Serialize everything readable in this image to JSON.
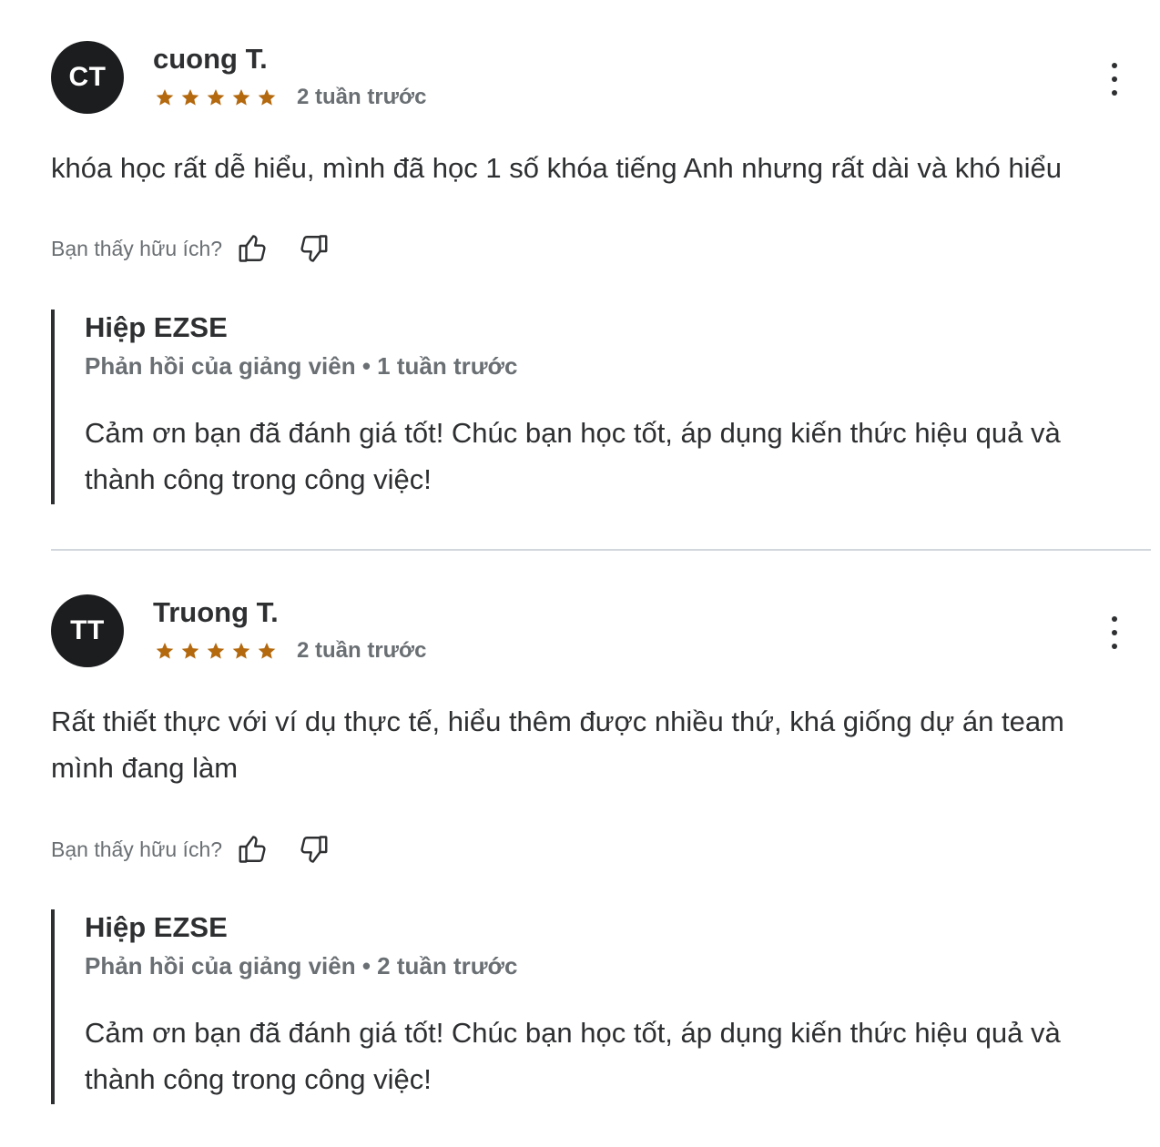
{
  "colors": {
    "star": "#b4690e",
    "avatar_bg": "#1c1d1f",
    "text": "#2d2f31",
    "muted": "#6a6f73",
    "divider": "#d1d7dc"
  },
  "reviews": [
    {
      "initials": "CT",
      "name": "cuong T.",
      "rating": 5,
      "time": "2 tuần trước",
      "content": "khóa học rất dễ hiểu, mình đã học 1 số khóa tiếng Anh nhưng rất dài và khó hiểu",
      "helpful_label": "Bạn thấy hữu ích?",
      "reply": {
        "name": "Hiệp EZSE",
        "meta": "Phản hồi của giảng viên • 1 tuần trước",
        "text": "Cảm ơn bạn đã đánh giá tốt! Chúc bạn học tốt, áp dụng kiến thức hiệu quả và thành công trong công việc!"
      }
    },
    {
      "initials": "TT",
      "name": "Truong T.",
      "rating": 5,
      "time": "2 tuần trước",
      "content": "Rất thiết thực với ví dụ thực tế, hiểu thêm được nhiều thứ, khá giống dự án team mình đang làm",
      "helpful_label": "Bạn thấy hữu ích?",
      "reply": {
        "name": "Hiệp EZSE",
        "meta": "Phản hồi của giảng viên • 2 tuần trước",
        "text": "Cảm ơn bạn đã đánh giá tốt! Chúc bạn học tốt, áp dụng kiến thức hiệu quả và thành công trong công việc!"
      }
    }
  ],
  "icons": {
    "star": "star-icon",
    "more": "more-vertical-icon",
    "thumbs_up": "thumbs-up-icon",
    "thumbs_down": "thumbs-down-icon"
  }
}
